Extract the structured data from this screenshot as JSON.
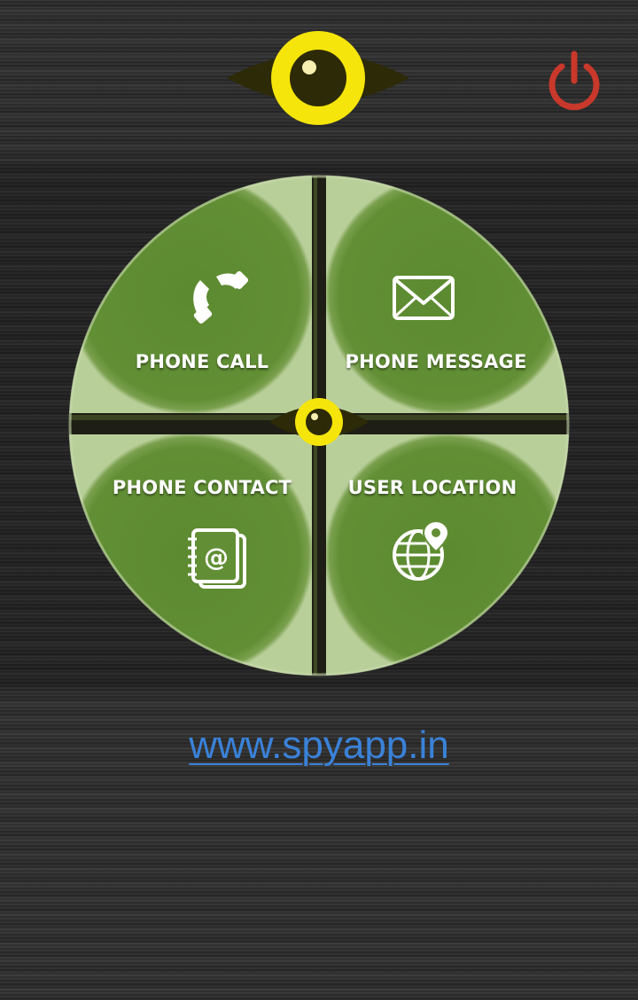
{
  "header": {
    "logo_icon": "eye-logo-icon",
    "power_icon": "power-icon"
  },
  "menu": {
    "items": [
      {
        "label": "PHONE CALL",
        "icon": "phone-icon"
      },
      {
        "label": "PHONE MESSAGE",
        "icon": "envelope-icon"
      },
      {
        "label": "PHONE CONTACT",
        "icon": "address-book-icon"
      },
      {
        "label": "USER LOCATION",
        "icon": "globe-location-icon"
      }
    ],
    "center_icon": "eye-center-icon"
  },
  "footer": {
    "website_link": "www.spyapp.in"
  },
  "colors": {
    "quadrant_green": "#5f8c33",
    "eye_yellow": "#f5e50a",
    "eye_dark": "#2d2a08",
    "power_red": "#c8382b",
    "link_blue": "#3a82d8"
  }
}
